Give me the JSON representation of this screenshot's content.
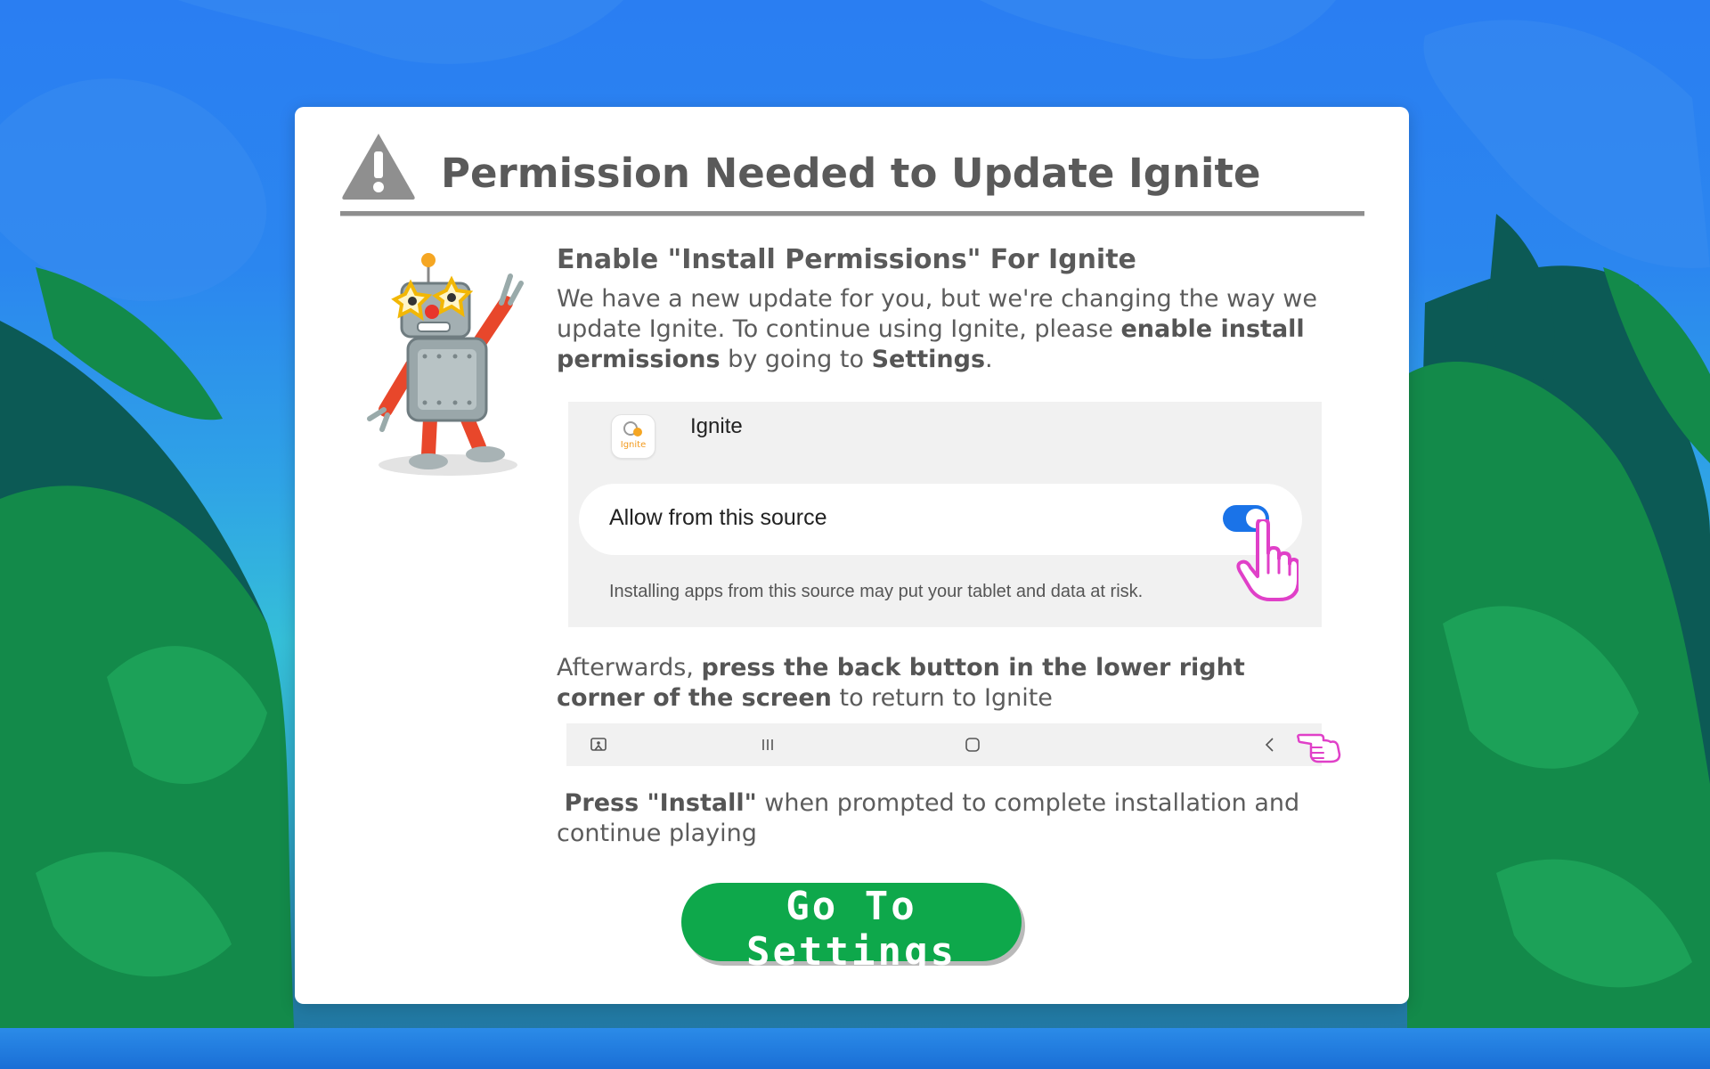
{
  "dialog": {
    "title": "Permission Needed to Update Ignite",
    "subtitle": "Enable \"Install Permissions\" For Ignite",
    "intro": {
      "part1": "We have a new update for you, but we're changing the way we update Ignite. To continue using Ignite, please ",
      "bold1": "enable install permissions",
      "part2": " by going to ",
      "bold2": "Settings",
      "part3": "."
    },
    "settings_preview": {
      "app_name": "Ignite",
      "app_icon_text": "Ignite",
      "allow_label": "Allow from this source",
      "toggle_on": true,
      "risk_note": "Installing apps from this source may put your tablet and data at risk."
    },
    "afterwards": {
      "part1": "Afterwards, ",
      "bold1": "press the back button in the lower right corner of the screen",
      "part2": " to return to Ignite"
    },
    "nav_icons": [
      "screenshot-icon",
      "recents-icon",
      "home-icon",
      "back-icon"
    ],
    "final": {
      "bold1": "Press \"Install\"",
      "part1": " when prompted to complete installation and continue playing"
    },
    "button_label": "Go To Settings"
  },
  "colors": {
    "button": "#0ea84b",
    "toggle": "#1a73e8",
    "pointer": "#e040c8",
    "title_text": "#5a5a5a"
  }
}
